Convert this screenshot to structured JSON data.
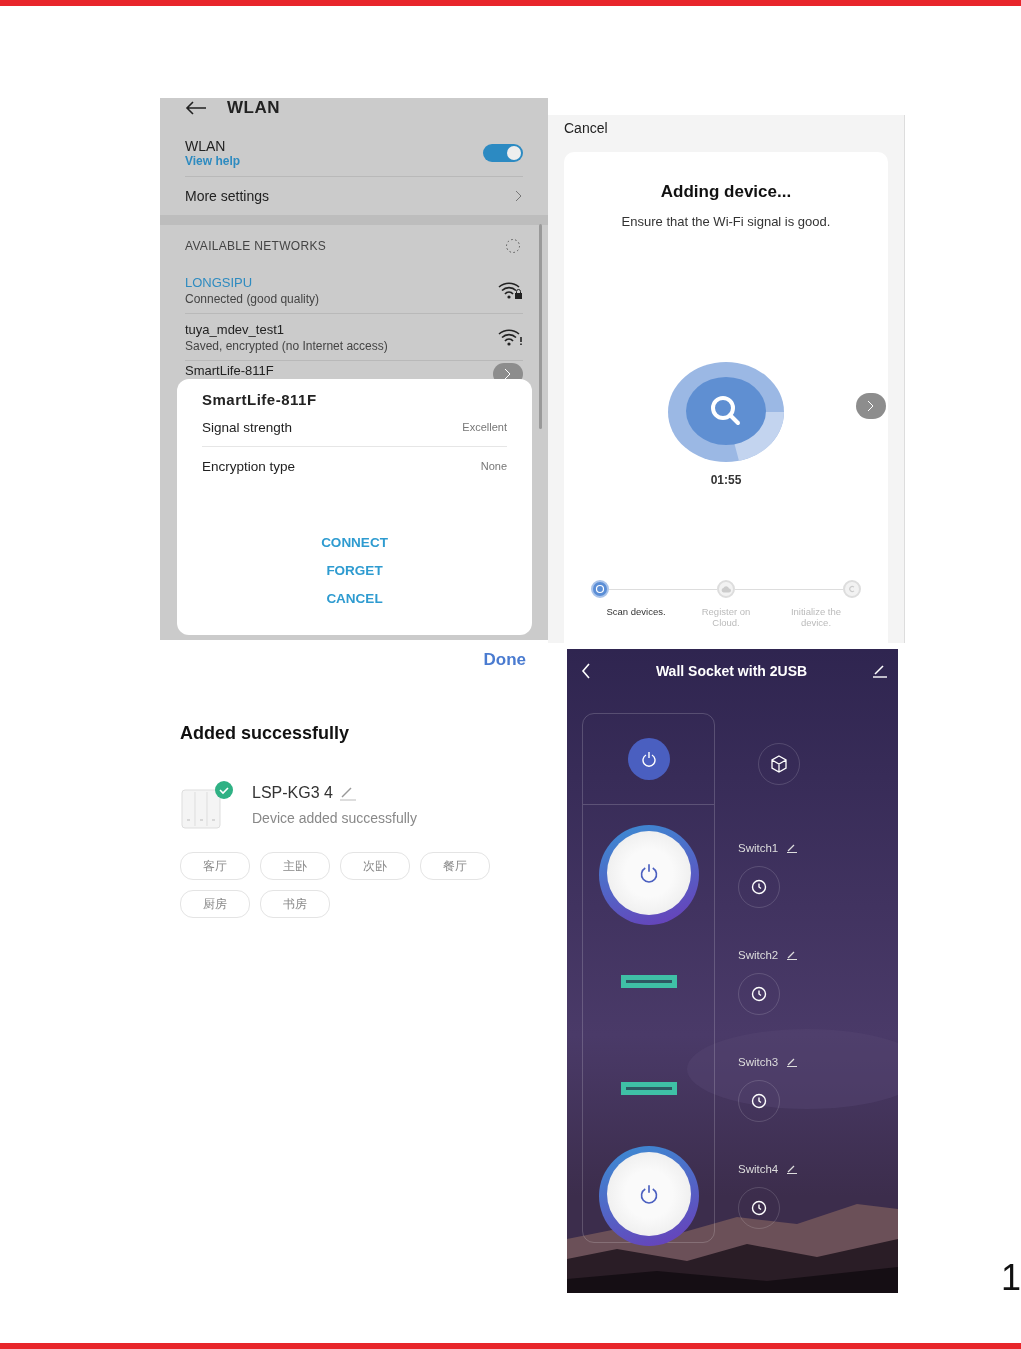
{
  "wlan_screen": {
    "title": "WLAN",
    "toggle": {
      "label": "WLAN",
      "link": "View help",
      "on": true
    },
    "more_settings": "More settings",
    "section_header": "AVAILABLE NETWORKS",
    "networks": [
      {
        "name": "LONGSIPU",
        "status": "Connected (good quality)",
        "connected": true,
        "kind": "locked"
      },
      {
        "name": "tuya_mdev_test1",
        "status": "Saved, encrypted (no Internet access)",
        "connected": false,
        "kind": "no-internet"
      }
    ],
    "partial_network": "SmartLife-811F",
    "dialog": {
      "title": "SmartLife-811F",
      "rows": [
        {
          "label": "Signal strength",
          "value": "Excellent"
        },
        {
          "label": "Encryption type",
          "value": "None"
        }
      ],
      "buttons": [
        "CONNECT",
        "FORGET",
        "CANCEL"
      ]
    }
  },
  "adding_screen": {
    "cancel": "Cancel",
    "title": "Adding device...",
    "subtitle": "Ensure that the Wi-Fi signal is good.",
    "timer": "01:55",
    "steps": [
      {
        "label": "Scan devices.",
        "selected": true,
        "kind": "scan"
      },
      {
        "label": "Register on Cloud.",
        "selected": false,
        "kind": "cloud"
      },
      {
        "label": "Initialize the device.",
        "selected": false,
        "kind": "init"
      }
    ]
  },
  "added_screen": {
    "done": "Done",
    "title": "Added successfully",
    "device": {
      "name": "LSP-KG3 4",
      "status": "Device added successfully"
    },
    "rooms": [
      "客厅",
      "主卧",
      "次卧",
      "餐厅",
      "厨房",
      "书房"
    ]
  },
  "socket_screen": {
    "title": "Wall Socket with 2USB",
    "master_on": true,
    "switches": [
      {
        "name": "Switch1",
        "kind": "outlet"
      },
      {
        "name": "Switch2",
        "kind": "usb"
      },
      {
        "name": "Switch3",
        "kind": "usb"
      },
      {
        "name": "Switch4",
        "kind": "outlet"
      }
    ]
  },
  "page_number": "1"
}
